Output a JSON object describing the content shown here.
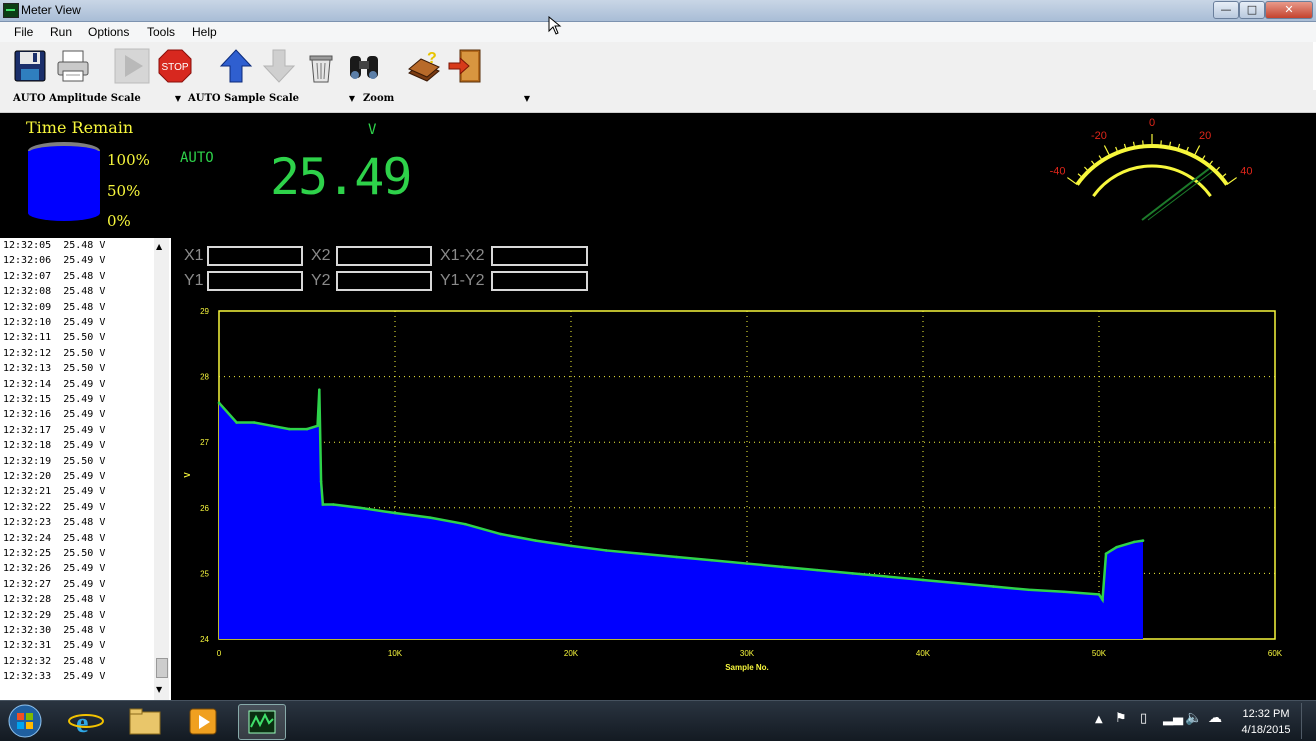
{
  "window": {
    "title": "Meter View"
  },
  "menu": [
    "File",
    "Run",
    "Options",
    "Tools",
    "Help"
  ],
  "toolbar": {
    "buttons": [
      "save",
      "print",
      "run",
      "stop",
      "scroll-up",
      "scroll-down",
      "clear",
      "find",
      "help-book",
      "exit"
    ],
    "stop_label": "STOP"
  },
  "dropdowns": {
    "amplitude": "AUTO Amplitude Scale",
    "sample": "AUTO Sample Scale",
    "zoom": "Zoom"
  },
  "display": {
    "time_remain_label": "Time Remain",
    "tank_levels": [
      "100%",
      "50%",
      "0%"
    ],
    "tank_fill": 1.0,
    "mode": "AUTO",
    "unit": "V",
    "reading": "25.49"
  },
  "gauge": {
    "ticks": [
      "-40",
      "-20",
      "0",
      "20",
      "40"
    ],
    "needle_value": 29
  },
  "log": [
    {
      "time": "12:32:05",
      "value": "25.48",
      "unit": "V"
    },
    {
      "time": "12:32:06",
      "value": "25.49",
      "unit": "V"
    },
    {
      "time": "12:32:07",
      "value": "25.48",
      "unit": "V"
    },
    {
      "time": "12:32:08",
      "value": "25.48",
      "unit": "V"
    },
    {
      "time": "12:32:09",
      "value": "25.48",
      "unit": "V"
    },
    {
      "time": "12:32:10",
      "value": "25.49",
      "unit": "V"
    },
    {
      "time": "12:32:11",
      "value": "25.50",
      "unit": "V"
    },
    {
      "time": "12:32:12",
      "value": "25.50",
      "unit": "V"
    },
    {
      "time": "12:32:13",
      "value": "25.50",
      "unit": "V"
    },
    {
      "time": "12:32:14",
      "value": "25.49",
      "unit": "V"
    },
    {
      "time": "12:32:15",
      "value": "25.49",
      "unit": "V"
    },
    {
      "time": "12:32:16",
      "value": "25.49",
      "unit": "V"
    },
    {
      "time": "12:32:17",
      "value": "25.49",
      "unit": "V"
    },
    {
      "time": "12:32:18",
      "value": "25.49",
      "unit": "V"
    },
    {
      "time": "12:32:19",
      "value": "25.50",
      "unit": "V"
    },
    {
      "time": "12:32:20",
      "value": "25.49",
      "unit": "V"
    },
    {
      "time": "12:32:21",
      "value": "25.49",
      "unit": "V"
    },
    {
      "time": "12:32:22",
      "value": "25.49",
      "unit": "V"
    },
    {
      "time": "12:32:23",
      "value": "25.48",
      "unit": "V"
    },
    {
      "time": "12:32:24",
      "value": "25.48",
      "unit": "V"
    },
    {
      "time": "12:32:25",
      "value": "25.50",
      "unit": "V"
    },
    {
      "time": "12:32:26",
      "value": "25.49",
      "unit": "V"
    },
    {
      "time": "12:32:27",
      "value": "25.49",
      "unit": "V"
    },
    {
      "time": "12:32:28",
      "value": "25.48",
      "unit": "V"
    },
    {
      "time": "12:32:29",
      "value": "25.48",
      "unit": "V"
    },
    {
      "time": "12:32:30",
      "value": "25.48",
      "unit": "V"
    },
    {
      "time": "12:32:31",
      "value": "25.49",
      "unit": "V"
    },
    {
      "time": "12:32:32",
      "value": "25.48",
      "unit": "V"
    },
    {
      "time": "12:32:33",
      "value": "25.49",
      "unit": "V"
    }
  ],
  "cursors": {
    "x1": "X1",
    "x2": "X2",
    "dx": "X1-X2",
    "y1": "Y1",
    "y2": "Y2",
    "dy": "Y1-Y2"
  },
  "colors": {
    "fill": "#0000ff",
    "trace": "#2ed24a",
    "grid": "#f7f73c",
    "axis_text": "#f7f73c"
  },
  "chart_data": {
    "type": "area",
    "xlabel": "Sample No.",
    "ylabel": "V",
    "xlim": [
      0,
      60000
    ],
    "ylim": [
      24,
      29
    ],
    "x_ticks": [
      "0",
      "10K",
      "20K",
      "30K",
      "40K",
      "50K",
      "60K"
    ],
    "y_ticks": [
      "29",
      "28",
      "27",
      "26",
      "25",
      "24"
    ],
    "grid": true,
    "x": [
      0,
      1000,
      2000,
      3000,
      4000,
      5000,
      5600,
      5700,
      5800,
      5900,
      6500,
      8000,
      10000,
      12000,
      14000,
      16000,
      18000,
      20000,
      22000,
      24000,
      26000,
      28000,
      30000,
      32000,
      34000,
      36000,
      38000,
      40000,
      42000,
      44000,
      46000,
      48000,
      50000,
      50200,
      50400,
      51000,
      52000,
      52500
    ],
    "values": [
      27.6,
      27.3,
      27.3,
      27.25,
      27.2,
      27.2,
      27.25,
      27.8,
      26.4,
      26.05,
      26.05,
      26.0,
      25.92,
      25.85,
      25.75,
      25.6,
      25.5,
      25.42,
      25.35,
      25.3,
      25.25,
      25.2,
      25.15,
      25.1,
      25.05,
      25.0,
      24.95,
      24.9,
      24.85,
      24.8,
      24.75,
      24.72,
      24.68,
      24.6,
      25.3,
      25.4,
      25.48,
      25.5
    ]
  },
  "taskbar": {
    "time": "12:32 PM",
    "date": "4/18/2015"
  }
}
